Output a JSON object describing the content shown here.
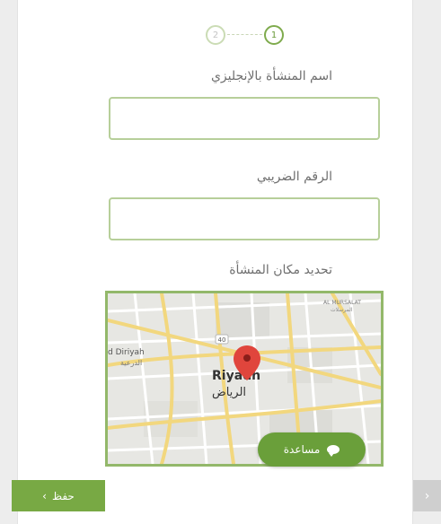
{
  "stepper": {
    "steps": [
      "2",
      "1"
    ],
    "active_step": "1"
  },
  "form": {
    "name_en_label": "اسم المنشأة بالإنجليزي",
    "name_en_value": "",
    "tax_label": "الرقم الضريبي",
    "tax_value": "",
    "location_label": "تحديد مكان المنشأة"
  },
  "map": {
    "city_en": "Riyadh",
    "city_ar": "الرياض",
    "district_en": "d Diriyah",
    "district_ar": "الدرعية",
    "neighborhood_en": "AL MURSALAT",
    "neighborhood_ar": "المرسلات",
    "road_badge": "40"
  },
  "help_button": {
    "label": "مساعدة",
    "icon": "chat-bubble-icon"
  },
  "footer": {
    "save_label": "حفظ",
    "save_icon": "chevron-left-icon",
    "next_icon": "chevron-right-icon"
  },
  "colors": {
    "accent": "#78a944",
    "accent_light": "#b7cf9a",
    "disabled": "#cfcfcf"
  }
}
